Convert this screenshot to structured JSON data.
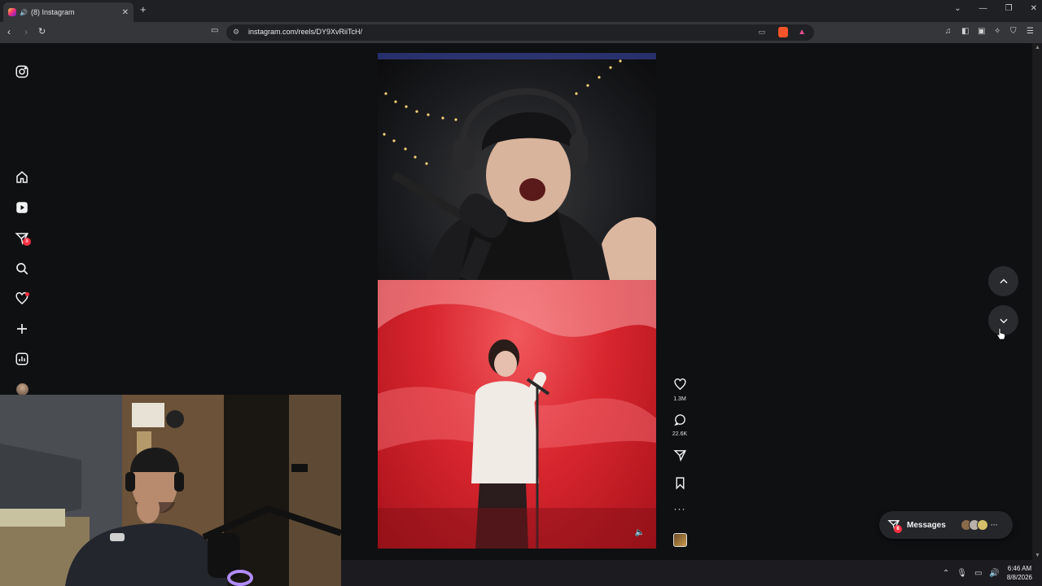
{
  "browser": {
    "tab_title": "(8) Instagram",
    "new_tab": "+",
    "url": "instagram.com/reels/DY9XvRiiTcH/",
    "win_controls": [
      "⌄",
      "—",
      "❐",
      "✕"
    ]
  },
  "sidebar": {
    "items": [
      {
        "name": "instagram-logo-icon"
      },
      {
        "name": "home-icon"
      },
      {
        "name": "reels-icon"
      },
      {
        "name": "messages-icon",
        "badge": "8"
      },
      {
        "name": "search-icon"
      },
      {
        "name": "notifications-icon",
        "dot": true
      },
      {
        "name": "create-icon"
      },
      {
        "name": "dashboard-icon"
      },
      {
        "name": "profile-avatar"
      }
    ]
  },
  "reel": {
    "actions": {
      "like_count": "1.3M",
      "comment_count": "22.6K"
    }
  },
  "messages": {
    "label": "Messages",
    "badge": "8",
    "more": "···"
  },
  "taskbar": {
    "time": "6:46 AM",
    "date": "8/8/2026"
  },
  "colors": {
    "badge": "#ff3040",
    "page_bg": "#0f1012"
  }
}
